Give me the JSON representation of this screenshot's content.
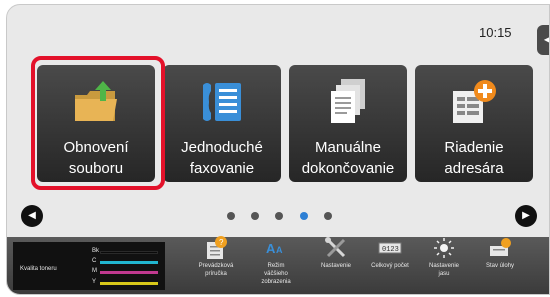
{
  "clock": "10:15",
  "side_tab_icon": "speaker-icon",
  "tiles": [
    {
      "label_line1": "Obnovení",
      "label_line2": "souboru",
      "icon": "folder-restore-icon",
      "selected": true
    },
    {
      "label_line1": "Jednoduché",
      "label_line2": "faxovanie",
      "icon": "fax-icon",
      "selected": false
    },
    {
      "label_line1": "Manuálne",
      "label_line2": "dokončovanie",
      "icon": "documents-icon",
      "selected": false
    },
    {
      "label_line1": "Riadenie",
      "label_line2": "adresára",
      "icon": "address-book-add-icon",
      "selected": false
    }
  ],
  "pager": {
    "pages": 5,
    "active_index": 3
  },
  "toner": {
    "title": "Kvalita toneru",
    "channels": [
      {
        "label": "Bk",
        "color": "#111111"
      },
      {
        "label": "C",
        "color": "#21b5cf"
      },
      {
        "label": "M",
        "color": "#c0398f"
      },
      {
        "label": "Y",
        "color": "#d8c81a"
      }
    ]
  },
  "bottom_items": [
    {
      "line1": "Prevádzková",
      "line2": "príručka",
      "line3": "",
      "icon": "manual-icon"
    },
    {
      "line1": "Režim",
      "line2": "väčšieho",
      "line3": "zobrazenia",
      "icon": "zoom-text-icon"
    },
    {
      "line1": "Nastavenie",
      "line2": "",
      "line3": "",
      "icon": "settings-tools-icon"
    },
    {
      "line1": "Celkový počet",
      "line2": "",
      "line3": "",
      "icon": "counter-icon"
    },
    {
      "line1": "Nastavenie",
      "line2": "jasu",
      "line3": "",
      "icon": "brightness-icon"
    },
    {
      "line1": "Stav úlohy",
      "line2": "",
      "line3": "",
      "icon": "job-status-icon"
    }
  ],
  "colors": {
    "selection": "#e3112a",
    "accent_green": "#4fb548",
    "accent_orange": "#f08a1c",
    "accent_blue": "#2d7fd4"
  }
}
